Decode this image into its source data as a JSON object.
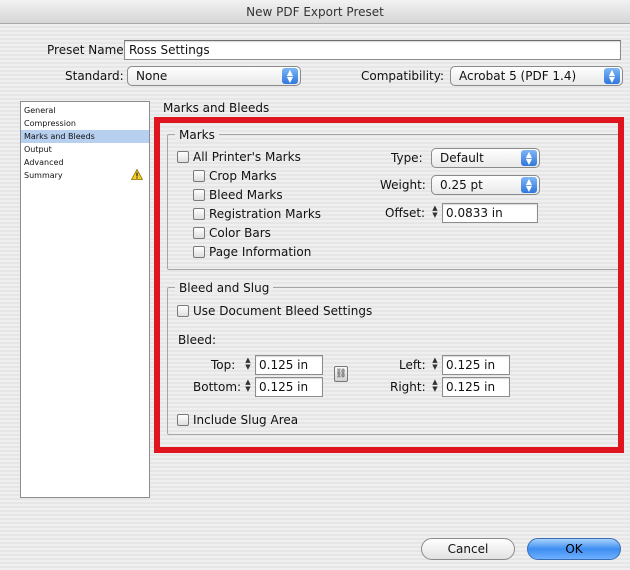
{
  "window": {
    "title": "New PDF Export Preset"
  },
  "preset": {
    "name_label": "Preset Name:",
    "name_value": "Ross Settings"
  },
  "standard": {
    "label": "Standard:",
    "value": "None"
  },
  "compatibility": {
    "label": "Compatibility:",
    "value": "Acrobat 5 (PDF 1.4)"
  },
  "sidebar": {
    "items": [
      {
        "label": "General"
      },
      {
        "label": "Compression"
      },
      {
        "label": "Marks and Bleeds",
        "selected": true
      },
      {
        "label": "Output"
      },
      {
        "label": "Advanced"
      },
      {
        "label": "Summary",
        "icon": "warning-icon"
      }
    ]
  },
  "panel": {
    "title": "Marks and Bleeds"
  },
  "marks": {
    "legend": "Marks",
    "all_printers": "All Printer's Marks",
    "crop": "Crop Marks",
    "bleed": "Bleed Marks",
    "registration": "Registration Marks",
    "color_bars": "Color Bars",
    "page_info": "Page Information",
    "type_label": "Type:",
    "type_value": "Default",
    "weight_label": "Weight:",
    "weight_value": "0.25 pt",
    "offset_label": "Offset:",
    "offset_value": "0.0833 in"
  },
  "bleed": {
    "legend": "Bleed and Slug",
    "use_doc": "Use Document Bleed Settings",
    "bleed_label": "Bleed:",
    "top_label": "Top:",
    "top_value": "0.125 in",
    "bottom_label": "Bottom:",
    "bottom_value": "0.125 in",
    "left_label": "Left:",
    "left_value": "0.125 in",
    "right_label": "Right:",
    "right_value": "0.125 in",
    "include_slug": "Include Slug Area"
  },
  "buttons": {
    "cancel": "Cancel",
    "ok": "OK"
  },
  "colors": {
    "highlight_border": "#e0141e",
    "selection": "#b8d0f0",
    "default_button": "#3d8ef0"
  }
}
